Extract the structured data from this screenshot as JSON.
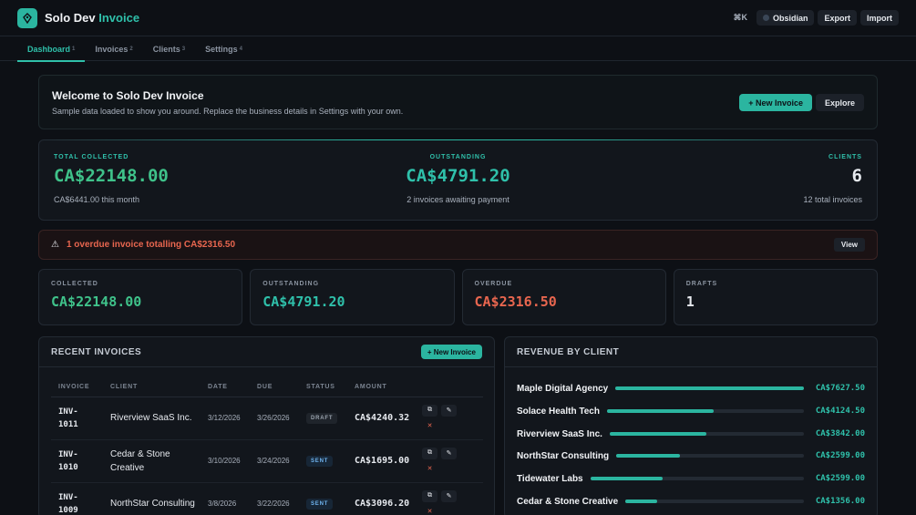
{
  "app": {
    "brand_main": "Solo Dev",
    "brand_accent": "Invoice"
  },
  "topbar": {
    "shortcut": "⌘K",
    "theme_label": "Obsidian",
    "export_label": "Export",
    "import_label": "Import"
  },
  "nav": [
    {
      "label": "Dashboard",
      "num": "1",
      "active": true
    },
    {
      "label": "Invoices",
      "num": "2"
    },
    {
      "label": "Clients",
      "num": "3"
    },
    {
      "label": "Settings",
      "num": "4"
    }
  ],
  "welcome": {
    "title": "Welcome to Solo Dev Invoice",
    "text": "Sample data loaded to show you around. Replace the business details in Settings with your own.",
    "new_invoice": "+ New Invoice",
    "explore": "Explore"
  },
  "summary": {
    "collected": {
      "label": "TOTAL COLLECTED",
      "value": "CA$22148.00",
      "sub": "CA$6441.00 this month"
    },
    "outstanding": {
      "label": "OUTSTANDING",
      "value": "CA$4791.20",
      "sub": "2 invoices awaiting payment"
    },
    "clients": {
      "label": "CLIENTS",
      "value": "6",
      "sub": "12 total invoices"
    }
  },
  "overdue_alert": {
    "icon": "⚠",
    "message": "1 overdue invoice totalling CA$2316.50",
    "view": "View"
  },
  "cards": [
    {
      "label": "COLLECTED",
      "value": "CA$22148.00"
    },
    {
      "label": "OUTSTANDING",
      "value": "CA$4791.20"
    },
    {
      "label": "OVERDUE",
      "value": "CA$2316.50"
    },
    {
      "label": "DRAFTS",
      "value": "1"
    }
  ],
  "recent": {
    "title": "RECENT INVOICES",
    "new_invoice": "+ New Invoice",
    "headers": [
      "INVOICE",
      "CLIENT",
      "DATE",
      "DUE",
      "STATUS",
      "AMOUNT"
    ],
    "rows": [
      {
        "inv1": "INV-",
        "inv2": "1011",
        "client": "Riverview SaaS Inc.",
        "date": "3/12/2026",
        "due": "3/26/2026",
        "status": "DRAFT",
        "amount": "CA$4240.32"
      },
      {
        "inv1": "INV-",
        "inv2": "1010",
        "client": "Cedar & Stone Creative",
        "date": "3/10/2026",
        "due": "3/24/2026",
        "status": "SENT",
        "amount": "CA$1695.00"
      },
      {
        "inv1": "INV-",
        "inv2": "1009",
        "client": "NorthStar Consulting",
        "date": "3/8/2026",
        "due": "3/22/2026",
        "status": "SENT",
        "amount": "CA$3096.20"
      }
    ],
    "copy_glyph": "⧉",
    "edit_glyph": "✎",
    "delete_glyph": "✕"
  },
  "revenue": {
    "title": "REVENUE BY CLIENT",
    "items": [
      {
        "name": "Maple Digital Agency",
        "amount": "CA$7627.50",
        "share": 1.0
      },
      {
        "name": "Solace Health Tech",
        "amount": "CA$4124.50",
        "share": 0.54
      },
      {
        "name": "Riverview SaaS Inc.",
        "amount": "CA$3842.00",
        "share": 0.5
      },
      {
        "name": "NorthStar Consulting",
        "amount": "CA$2599.00",
        "share": 0.34
      },
      {
        "name": "Tidewater Labs",
        "amount": "CA$2599.00",
        "share": 0.34
      },
      {
        "name": "Cedar & Stone Creative",
        "amount": "CA$1356.00",
        "share": 0.18
      }
    ]
  },
  "colors": {
    "accent": "#2bb5a0",
    "success": "#3fc28a",
    "danger": "#e8664f",
    "background": "#0d1015"
  }
}
